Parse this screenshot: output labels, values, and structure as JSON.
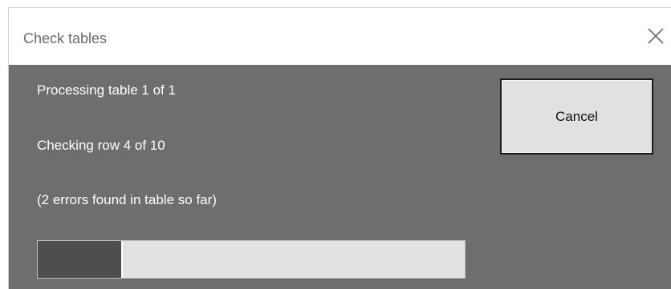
{
  "window": {
    "title": "Check tables"
  },
  "status": {
    "table_progress": "Processing table 1 of 1",
    "row_progress": "Checking row 4 of 10",
    "errors": "(2 errors found in table so far)"
  },
  "actions": {
    "cancel_label": "Cancel"
  },
  "progress": {
    "fraction": 0.2
  },
  "icons": {
    "close": "close-icon"
  },
  "colors": {
    "body_background": "#6e6e6e",
    "progress_fill": "#4e4e4e",
    "progress_track": "#e2e2e2"
  }
}
